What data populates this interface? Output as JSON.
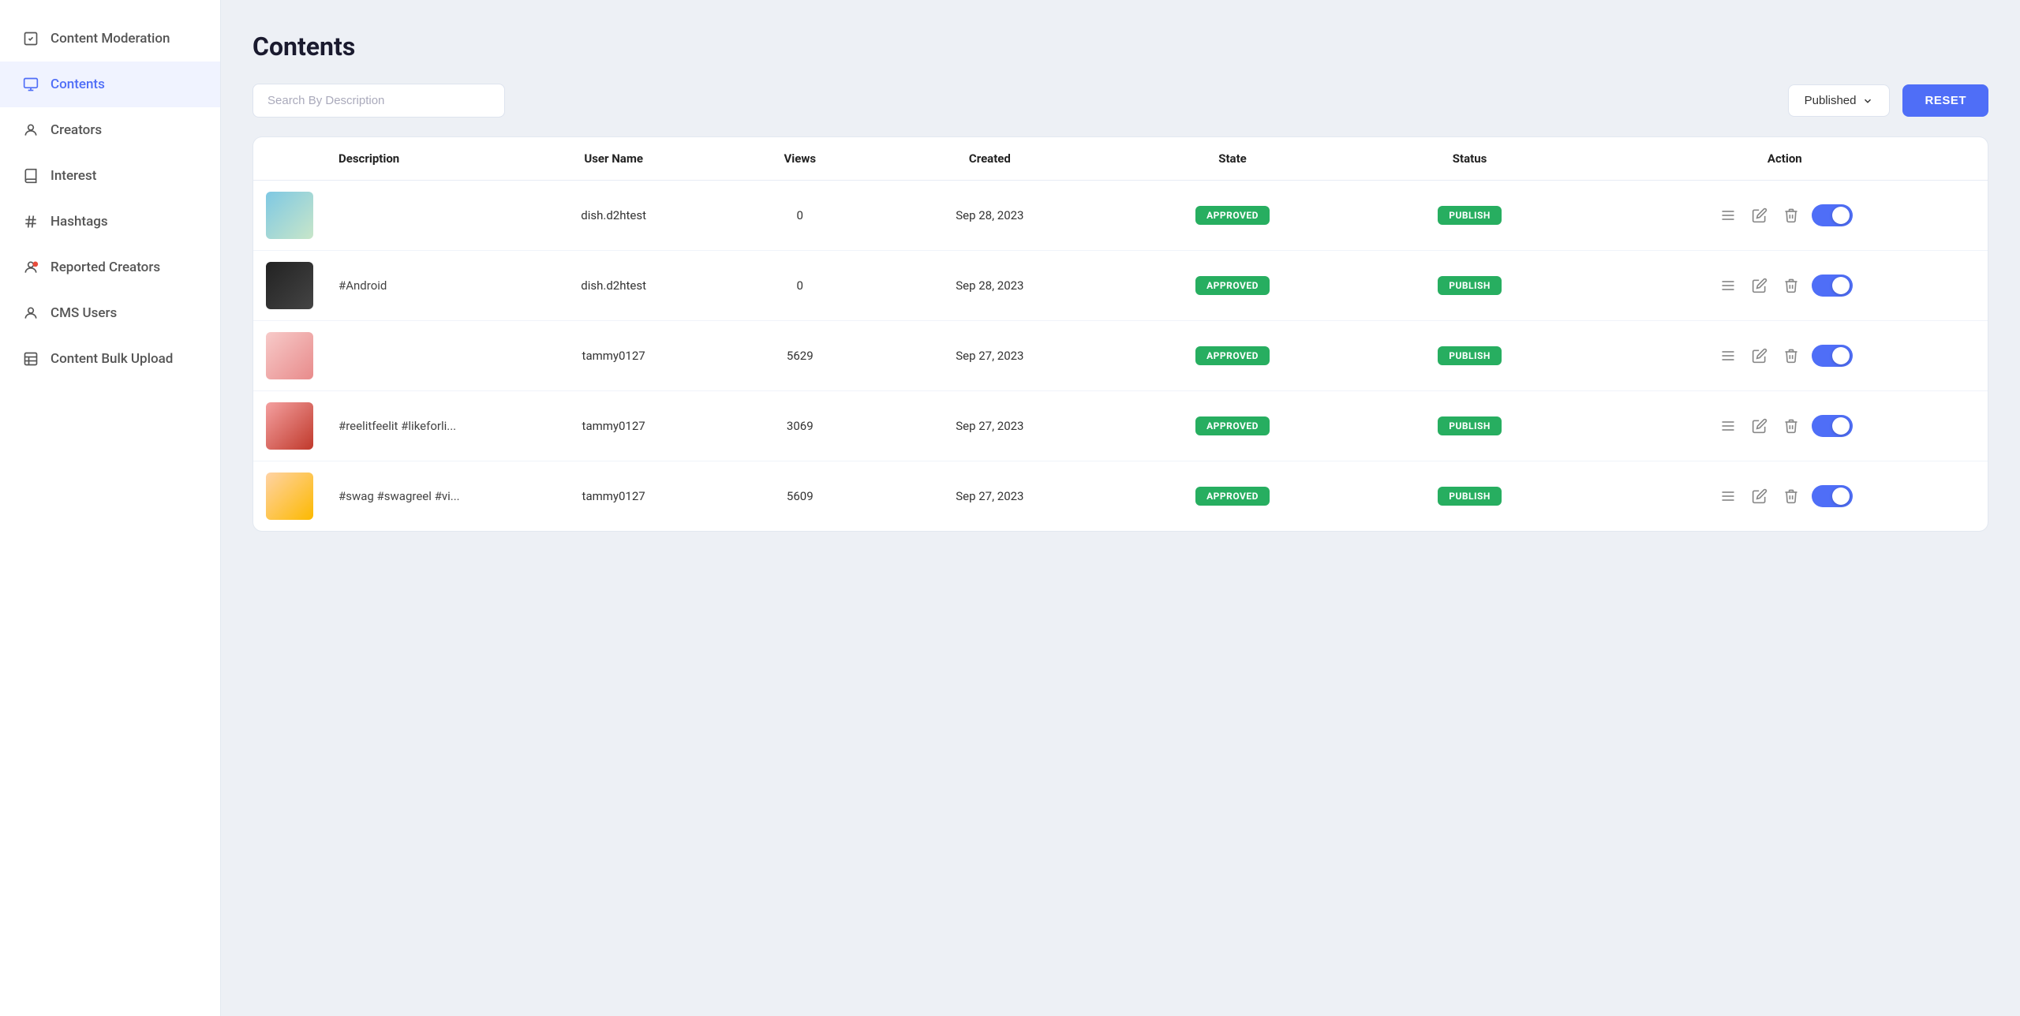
{
  "sidebar": {
    "items": [
      {
        "id": "content-moderation",
        "label": "Content Moderation",
        "icon": "moderation-icon",
        "active": false
      },
      {
        "id": "contents",
        "label": "Contents",
        "icon": "contents-icon",
        "active": true
      },
      {
        "id": "creators",
        "label": "Creators",
        "icon": "creators-icon",
        "active": false
      },
      {
        "id": "interest",
        "label": "Interest",
        "icon": "interest-icon",
        "active": false
      },
      {
        "id": "hashtags",
        "label": "Hashtags",
        "icon": "hashtags-icon",
        "active": false
      },
      {
        "id": "reported-creators",
        "label": "Reported Creators",
        "icon": "reported-icon",
        "active": false
      },
      {
        "id": "cms-users",
        "label": "CMS Users",
        "icon": "cms-icon",
        "active": false
      },
      {
        "id": "content-bulk-upload",
        "label": "Content Bulk Upload",
        "icon": "upload-icon",
        "active": false
      }
    ]
  },
  "page": {
    "title": "Contents",
    "search_placeholder": "Search By Description",
    "filter_label": "Published",
    "reset_label": "RESET"
  },
  "table": {
    "columns": [
      "",
      "Description",
      "User Name",
      "Views",
      "Created",
      "State",
      "Status",
      "Action"
    ],
    "rows": [
      {
        "thumb_class": "thumb-cricket",
        "description": "",
        "username": "dish.d2htest",
        "views": "0",
        "created": "Sep 28, 2023",
        "state": "APPROVED",
        "status": "PUBLISH",
        "enabled": true
      },
      {
        "thumb_class": "thumb-android",
        "description": "#Android",
        "username": "dish.d2htest",
        "views": "0",
        "created": "Sep 28, 2023",
        "state": "APPROVED",
        "status": "PUBLISH",
        "enabled": true
      },
      {
        "thumb_class": "thumb-girl1",
        "description": "",
        "username": "tammy0127",
        "views": "5629",
        "created": "Sep 27, 2023",
        "state": "APPROVED",
        "status": "PUBLISH",
        "enabled": true
      },
      {
        "thumb_class": "thumb-girl2",
        "description": "#reelitfeelit #likeforli...",
        "username": "tammy0127",
        "views": "3069",
        "created": "Sep 27, 2023",
        "state": "APPROVED",
        "status": "PUBLISH",
        "enabled": true
      },
      {
        "thumb_class": "thumb-girl3",
        "description": "#swag #swagreel #vi...",
        "username": "tammy0127",
        "views": "5609",
        "created": "Sep 27, 2023",
        "state": "APPROVED",
        "status": "PUBLISH",
        "enabled": true
      }
    ]
  }
}
